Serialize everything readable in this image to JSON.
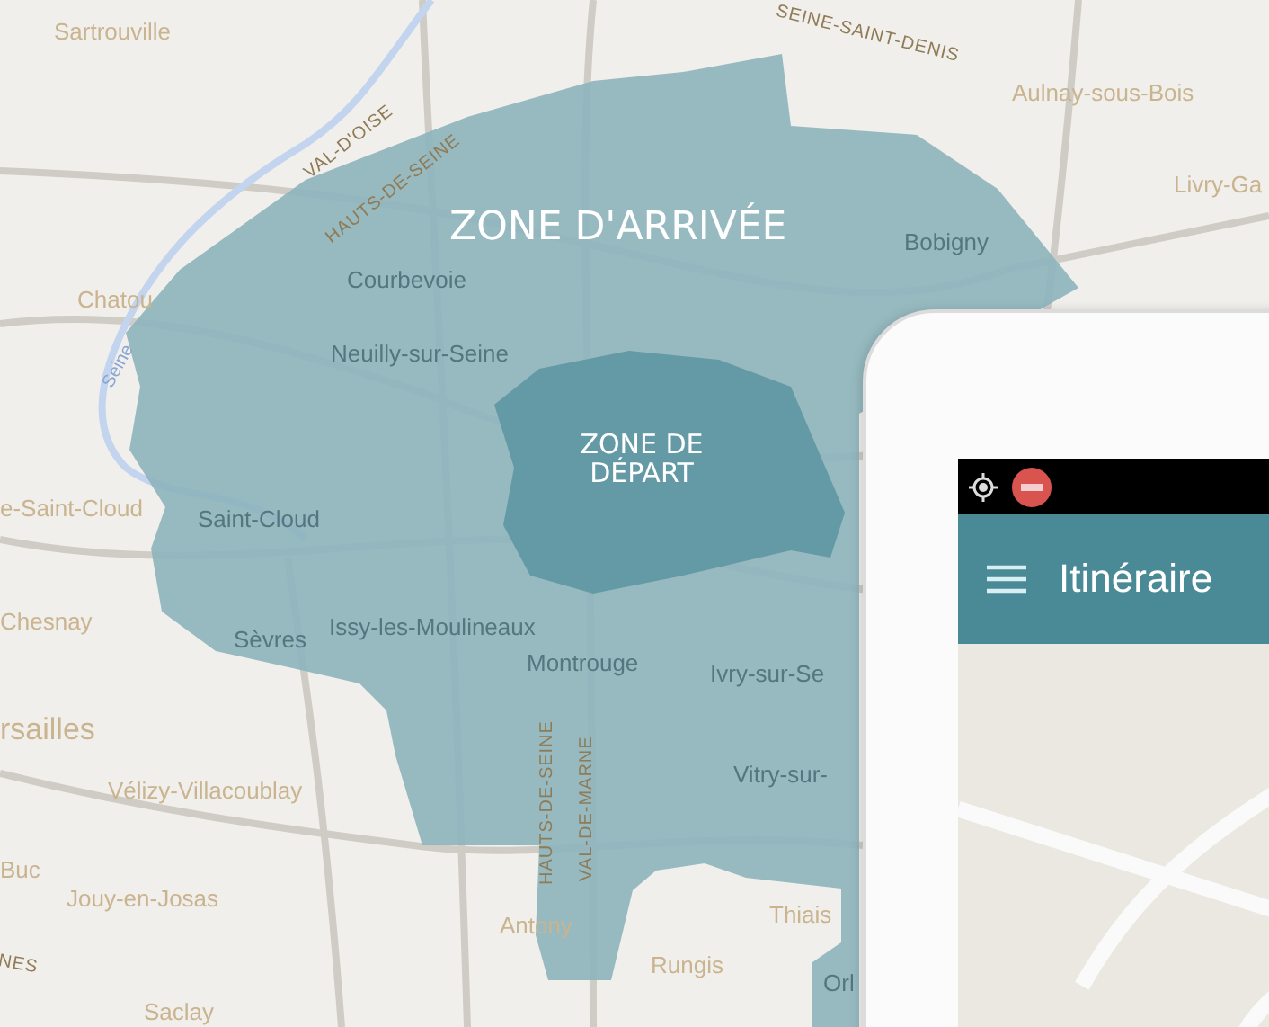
{
  "map": {
    "labels": [
      {
        "text": "Sartrouville",
        "kind": "town"
      },
      {
        "text": "SEINE-SAINT-DENIS",
        "kind": "region"
      },
      {
        "text": "Aulnay-sous-Bois",
        "kind": "town"
      },
      {
        "text": "VAL-D'OISE",
        "kind": "region"
      },
      {
        "text": "HAUTS-DE-SEINE",
        "kind": "region"
      },
      {
        "text": "Livry-Ga",
        "kind": "town"
      },
      {
        "text": "Bobigny",
        "kind": "muted"
      },
      {
        "text": "Chatou",
        "kind": "town"
      },
      {
        "text": "Courbevoie",
        "kind": "muted"
      },
      {
        "text": "Seine",
        "kind": "river"
      },
      {
        "text": "Neuilly-sur-Seine",
        "kind": "muted"
      },
      {
        "text": "e-Saint-Cloud",
        "kind": "town"
      },
      {
        "text": "Saint-Cloud",
        "kind": "muted"
      },
      {
        "text": "Chesnay",
        "kind": "town"
      },
      {
        "text": "Sèvres",
        "kind": "muted"
      },
      {
        "text": "Issy-les-Moulineaux",
        "kind": "muted"
      },
      {
        "text": "Montrouge",
        "kind": "muted"
      },
      {
        "text": "Ivry-sur-Se",
        "kind": "muted"
      },
      {
        "text": "rsailles",
        "kind": "big"
      },
      {
        "text": "HAUTS-DE-SEINE",
        "kind": "region"
      },
      {
        "text": "VAL-DE-MARNE",
        "kind": "region"
      },
      {
        "text": "Vitry-sur-",
        "kind": "muted"
      },
      {
        "text": "Vélizy-Villacoublay",
        "kind": "town"
      },
      {
        "text": "Buc",
        "kind": "town"
      },
      {
        "text": "Jouy-en-Josas",
        "kind": "town"
      },
      {
        "text": "Thiais",
        "kind": "town"
      },
      {
        "text": "NES",
        "kind": "region"
      },
      {
        "text": "Antony",
        "kind": "town"
      },
      {
        "text": "Rungis",
        "kind": "town"
      },
      {
        "text": "Orl",
        "kind": "muted"
      },
      {
        "text": "Saclay",
        "kind": "town"
      }
    ],
    "zones": [
      {
        "name": "ZONE D'ARRIVÉE",
        "kind": "arrival"
      },
      {
        "name": "ZONE DE DÉPART",
        "kind": "departure"
      }
    ]
  },
  "phone": {
    "title": "Itinéraire"
  }
}
